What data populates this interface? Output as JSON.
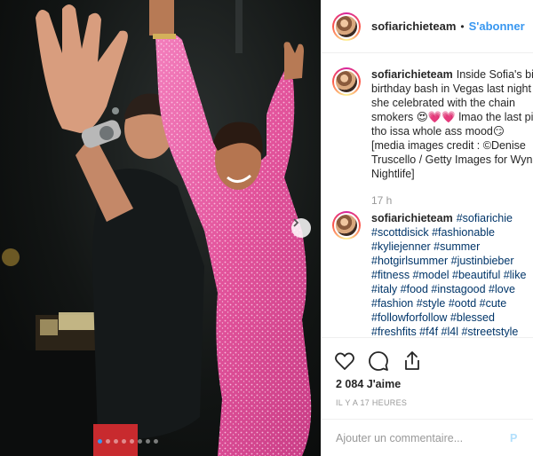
{
  "post": {
    "username": "sofiarichieteam",
    "header_separator": "•",
    "follow_label": "S'abonner"
  },
  "caption": {
    "username": "sofiarichieteam",
    "lines": [
      "Inside Sofia's big",
      "birthday bash in Vegas last night",
      "she celebrated with the chain",
      "smokers 😍💗💗 lmao the last pic",
      "tho issa whole ass mood😏",
      "[media images credit : ©Denise",
      "Truscello / Getty Images for Wyn",
      "Nightlife]"
    ],
    "time": "17 h"
  },
  "hashtags_comment": {
    "username": "sofiarichieteam",
    "lines": [
      "#sofiarichie",
      "#scottdisick #fashionable",
      "#kyliejenner #summer",
      "#hotgirlsummer #justinbieber",
      "#fitness #model #beautiful #like",
      "#italy #food #instagood #love",
      "#fashion #style #ootd #cute",
      "#followforfollow #blessed",
      "#freshfits #f4f #l4l #streetstyle"
    ]
  },
  "actions": {
    "icons": [
      "heart-icon",
      "comment-icon",
      "share-icon"
    ],
    "likes": "2 084 J'aime",
    "posted_ago": "IL Y A 17 HEURES"
  },
  "composer": {
    "placeholder": "Ajouter un commentaire...",
    "post_label": "P"
  },
  "carousel": {
    "slide_count": 8,
    "active_index": 0
  },
  "colors": {
    "accent": "#3897f0",
    "dress": "#e8559f"
  }
}
